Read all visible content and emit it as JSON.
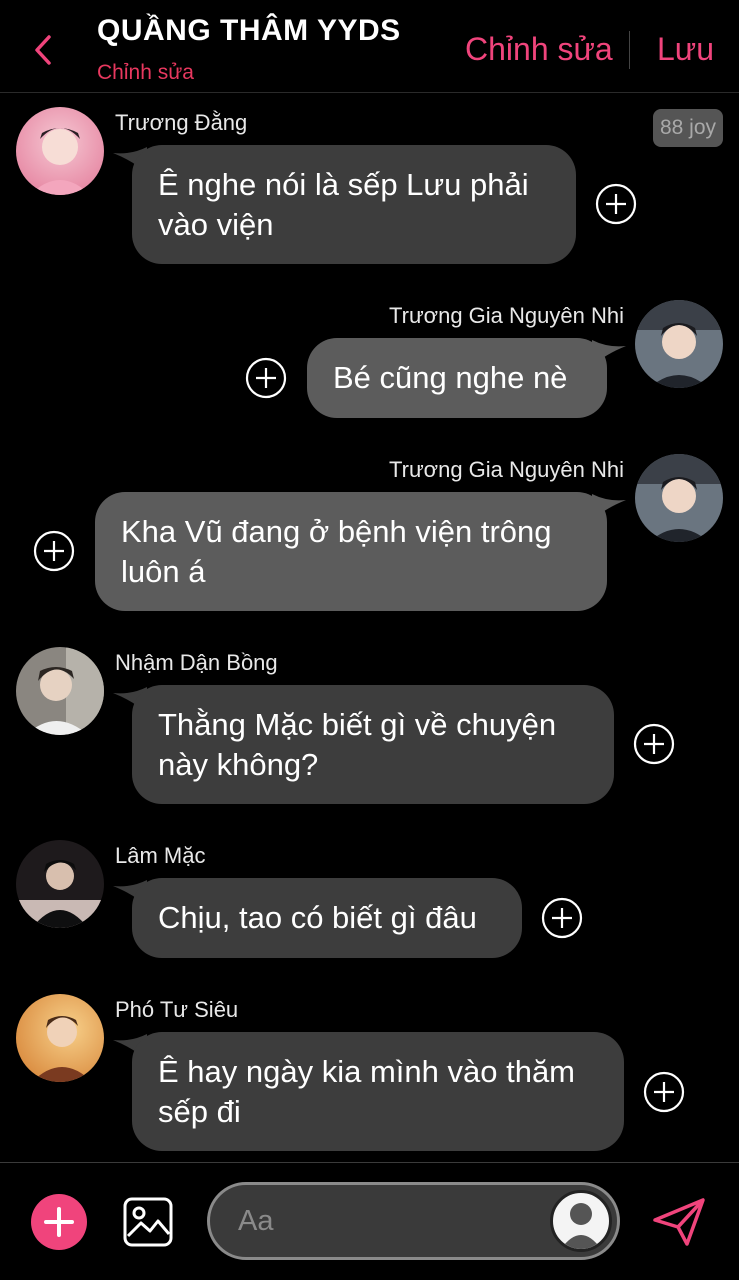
{
  "header": {
    "title": "QUẦNG THÂM YYDS",
    "subtitle": "Chỉnh sửa",
    "edit_label": "Chỉnh sửa",
    "save_label": "Lưu"
  },
  "badge": {
    "joy": "88 joy"
  },
  "messages": [
    {
      "sender": "Trương Đằng",
      "side": "left",
      "lines": [
        "Ê nghe nói là sếp Lưu phải",
        "vào viện"
      ]
    },
    {
      "sender": "Trương Gia Nguyên Nhi",
      "side": "right",
      "lines": [
        "Bé cũng nghe nè"
      ]
    },
    {
      "sender": "Trương Gia Nguyên Nhi",
      "side": "right",
      "lines": [
        "Kha Vũ đang ở bệnh viện trông",
        "luôn á"
      ]
    },
    {
      "sender": "Nhậm Dận Bồng",
      "side": "left",
      "lines": [
        "Thằng Mặc biết gì về chuyện",
        "này không?"
      ]
    },
    {
      "sender": "Lâm Mặc",
      "side": "left",
      "lines": [
        "Chịu, tao có biết gì đâu"
      ]
    },
    {
      "sender": "Phó Tư Siêu",
      "side": "left",
      "lines": [
        "Ê hay ngày kia mình vào thăm",
        "sếp đi"
      ]
    }
  ],
  "composer": {
    "placeholder": "Aa"
  },
  "icons": {
    "back": "chevron-left-icon",
    "add_reaction": "plus-circle-icon",
    "add": "plus-icon",
    "image": "image-icon",
    "send": "send-icon",
    "user": "user-silhouette-icon"
  },
  "colors": {
    "accent": "#f0447c",
    "subtitle": "#e8385f",
    "bubble_left": "#3d3d3d",
    "bubble_right": "#5c5c5c",
    "background": "#000000"
  }
}
